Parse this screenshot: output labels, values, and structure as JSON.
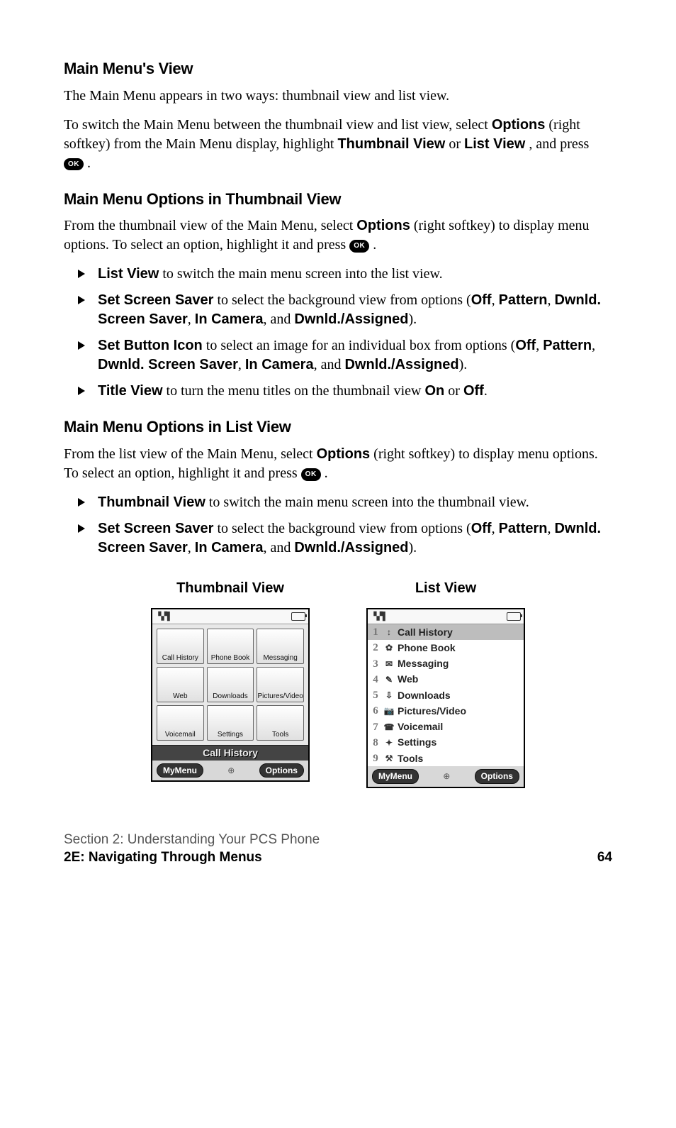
{
  "headings": {
    "h1": "Main Menu's View",
    "h2": "Main Menu Options in Thumbnail View",
    "h3": "Main Menu Options in List View"
  },
  "ok_label": "OK",
  "p1_a": "The Main Menu appears in two ways: thumbnail view and list view.",
  "p1_b_1": "To switch the Main Menu between the thumbnail view and list view, select ",
  "p1_b_options": "Options",
  "p1_b_2": " (right softkey) from the Main Menu display, highlight ",
  "p1_b_thumb": "Thumbnail View",
  "p1_b_or": " or ",
  "p1_b_list": "List View",
  "p1_b_3": ", and press ",
  "p1_b_4": " .",
  "p2_1": "From the thumbnail view of the Main Menu, select ",
  "p2_options": "Options",
  "p2_2": " (right softkey) to display menu options. To select an option, highlight it and press ",
  "p2_3": " .",
  "thumb_opts": {
    "i1_b": "List View",
    "i1_t": " to switch the main menu screen into the list view.",
    "i2_b": "Set Screen Saver",
    "i2_t1": " to select the background view from options (",
    "i2_off": "Off",
    "i2_c1": ", ",
    "i2_pattern": "Pattern",
    "i2_c2": ", ",
    "i2_dss": "Dwnld. Screen Saver",
    "i2_c3": ", ",
    "i2_incam": "In Camera",
    "i2_c4": ", and ",
    "i2_da": "Dwnld./Assigned",
    "i2_end": ").",
    "i3_b": "Set Button Icon",
    "i3_t1": " to select an image for an individual box from options (",
    "i4_b": "Title View",
    "i4_t1": " to turn the menu titles on the thumbnail view ",
    "i4_on": "On",
    "i4_or": " or ",
    "i4_off": "Off",
    "i4_end": "."
  },
  "p3_1": "From the list view of the Main Menu, select ",
  "p3_options": "Options",
  "p3_2": " (right softkey) to display menu options. To select an option, highlight it and press ",
  "p3_3": " .",
  "list_opts": {
    "i1_b": "Thumbnail View",
    "i1_t": " to switch the main menu screen into the thumbnail view.",
    "i2_b": "Set Screen Saver",
    "i2_t1": " to select the background view from options (",
    "i2_off": "Off",
    "i2_c1": ", ",
    "i2_pattern": "Pattern",
    "i2_c2": ", ",
    "i2_dss": "Dwnld. Screen Saver",
    "i2_c3": ", ",
    "i2_incam": "In Camera",
    "i2_c4": ", and ",
    "i2_da": "Dwnld./Assigned",
    "i2_end": ")."
  },
  "figs": {
    "thumb_title": "Thumbnail View",
    "list_title": "List View",
    "thumb_tiles": [
      "Call History",
      "Phone Book",
      "Messaging",
      "Web",
      "Downloads",
      "Pictures/Video",
      "Voicemail",
      "Settings",
      "Tools"
    ],
    "thumb_highlight": "Call History",
    "soft_left": "MyMenu",
    "soft_right": "Options",
    "list_items": [
      {
        "n": "1",
        "icon": "↕",
        "label": "Call History",
        "sel": true
      },
      {
        "n": "2",
        "icon": "✿",
        "label": "Phone Book",
        "sel": false
      },
      {
        "n": "3",
        "icon": "✉",
        "label": "Messaging",
        "sel": false
      },
      {
        "n": "4",
        "icon": "✎",
        "label": "Web",
        "sel": false
      },
      {
        "n": "5",
        "icon": "⇩",
        "label": "Downloads",
        "sel": false
      },
      {
        "n": "6",
        "icon": "📷",
        "label": "Pictures/Video",
        "sel": false
      },
      {
        "n": "7",
        "icon": "☎",
        "label": "Voicemail",
        "sel": false
      },
      {
        "n": "8",
        "icon": "✦",
        "label": "Settings",
        "sel": false
      },
      {
        "n": "9",
        "icon": "⚒",
        "label": "Tools",
        "sel": false
      }
    ]
  },
  "footer": {
    "section": "Section 2: Understanding Your PCS Phone",
    "sub": "2E: Navigating Through Menus",
    "page": "64"
  }
}
